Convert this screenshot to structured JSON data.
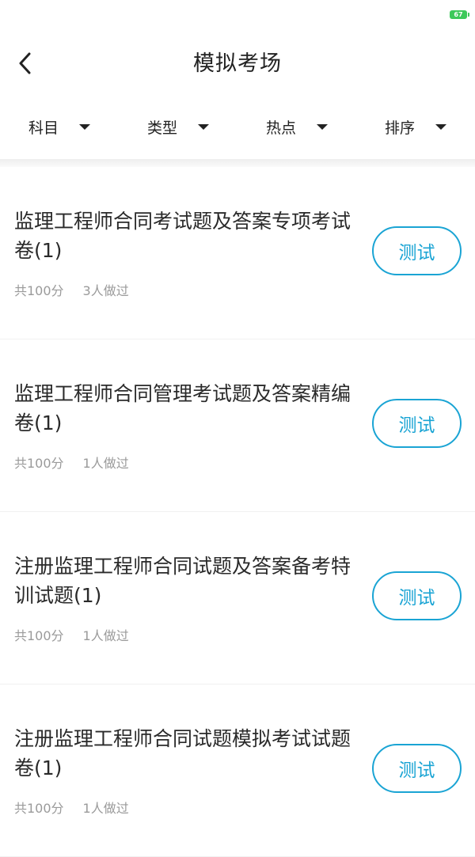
{
  "status_bar": {
    "battery_level": "67"
  },
  "header": {
    "title": "模拟考场",
    "back_icon": "chevron-left-icon"
  },
  "filters": [
    {
      "label": "科目",
      "icon": "caret-down-icon"
    },
    {
      "label": "类型",
      "icon": "caret-down-icon"
    },
    {
      "label": "热点",
      "icon": "caret-down-icon"
    },
    {
      "label": "排序",
      "icon": "caret-down-icon"
    }
  ],
  "exams": [
    {
      "title": "监理工程师合同考试题及答案专项考试卷(1)",
      "score": "共100分",
      "taken": "3人做过",
      "button": "测试"
    },
    {
      "title": "监理工程师合同管理考试题及答案精编卷(1)",
      "score": "共100分",
      "taken": "1人做过",
      "button": "测试"
    },
    {
      "title": "注册监理工程师合同试题及答案备考特训试题(1)",
      "score": "共100分",
      "taken": "1人做过",
      "button": "测试"
    },
    {
      "title": "注册监理工程师合同试题模拟考试试题卷(1)",
      "score": "共100分",
      "taken": "1人做过",
      "button": "测试"
    }
  ],
  "colors": {
    "accent": "#1aa4d4",
    "battery": "#3dc95a",
    "meta_text": "#9a9a9a"
  }
}
